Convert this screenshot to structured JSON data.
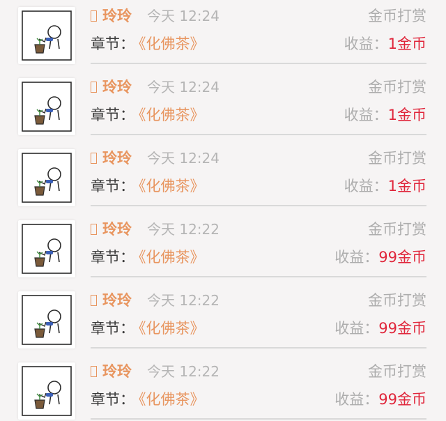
{
  "records": [
    {
      "user": "玲玲",
      "time": "今天 12:24",
      "type": "金币打赏",
      "chapter_label": "章节：",
      "chapter_title": "《化佛茶》",
      "income_label": "收益：",
      "income_amount": "1金币"
    },
    {
      "user": "玲玲",
      "time": "今天 12:24",
      "type": "金币打赏",
      "chapter_label": "章节：",
      "chapter_title": "《化佛茶》",
      "income_label": "收益：",
      "income_amount": "1金币"
    },
    {
      "user": "玲玲",
      "time": "今天 12:24",
      "type": "金币打赏",
      "chapter_label": "章节：",
      "chapter_title": "《化佛茶》",
      "income_label": "收益：",
      "income_amount": "1金币"
    },
    {
      "user": "玲玲",
      "time": "今天 12:22",
      "type": "金币打赏",
      "chapter_label": "章节：",
      "chapter_title": "《化佛茶》",
      "income_label": "收益：",
      "income_amount": "99金币"
    },
    {
      "user": "玲玲",
      "time": "今天 12:22",
      "type": "金币打赏",
      "chapter_label": "章节：",
      "chapter_title": "《化佛茶》",
      "income_label": "收益：",
      "income_amount": "99金币"
    },
    {
      "user": "玲玲",
      "time": "今天 12:22",
      "type": "金币打赏",
      "chapter_label": "章节：",
      "chapter_title": "《化佛茶》",
      "income_label": "收益：",
      "income_amount": "99金币"
    }
  ],
  "colors": {
    "accent": "#e8955f",
    "income": "#e0263b",
    "muted": "#adadad",
    "background": "#f6f4f4"
  },
  "icons": {
    "avatar": "cartoon-avatar-icon",
    "badge": "user-badge-icon"
  }
}
